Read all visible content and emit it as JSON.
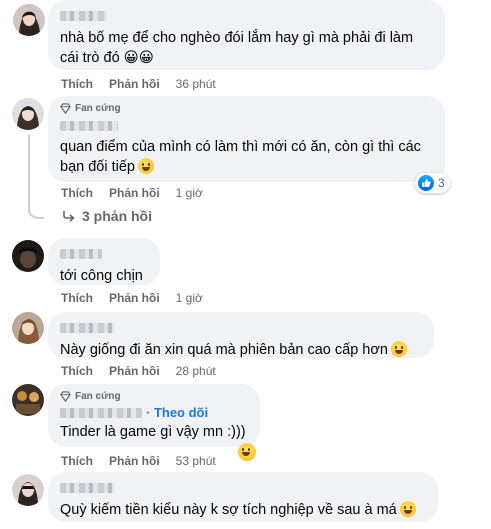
{
  "comments": [
    {
      "text": "nhà bố mẹ để cho nghèo đói lắm hay gì mà phải đi làm cái trò đó 😀😀",
      "actions": {
        "like": "Thích",
        "reply": "Phản hồi",
        "time": "36 phút"
      }
    },
    {
      "badge": "Fan cứng",
      "text": "quan điểm của mình có làm thì mới có ăn, còn gì thì các bạn đối tiếp",
      "actions": {
        "like": "Thích",
        "reply": "Phản hồi",
        "time": "1 giờ"
      },
      "reaction_count": "3",
      "replies_label": "3 phản hồi"
    },
    {
      "text": "tới công chịn",
      "actions": {
        "like": "Thích",
        "reply": "Phản hồi",
        "time": "1 giờ"
      }
    },
    {
      "text": "Này giống đi ăn xin quá mà phiên bản cao cấp hơn",
      "actions": {
        "like": "Thích",
        "reply": "Phản hồi",
        "time": "28 phút"
      }
    },
    {
      "badge": "Fan cứng",
      "follow": "· Theo dõi",
      "text": "Tinder là game gì vậy mn :)))",
      "actions": {
        "like": "Thích",
        "reply": "Phản hồi",
        "time": "53 phút"
      }
    },
    {
      "text": "Quỳ kiếm tiền kiểu này k sợ tích nghiệp về sau à má"
    }
  ],
  "colors": {
    "bubble": "#f0f2f5",
    "secondary_text": "#65676b",
    "link": "#1877f2",
    "like_blue": "#1877f2"
  }
}
